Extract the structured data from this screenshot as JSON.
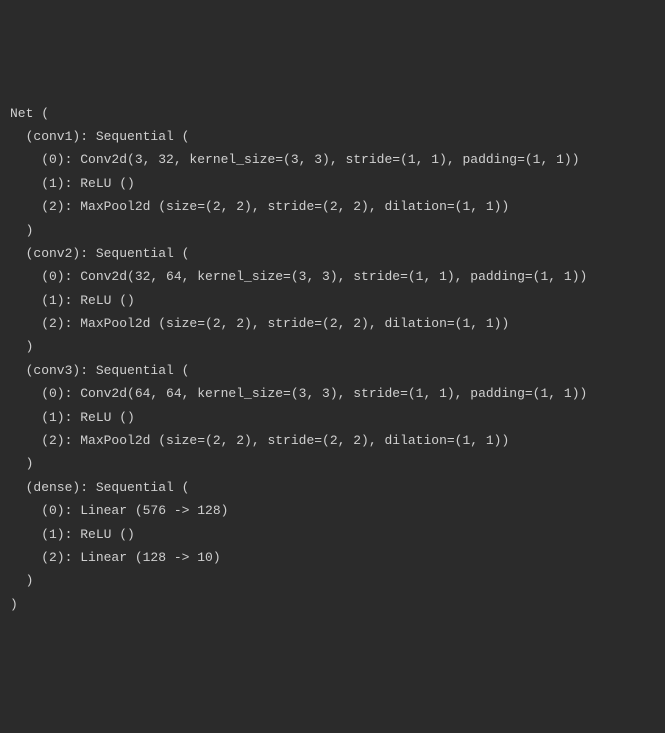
{
  "lines": [
    "Net (",
    "  (conv1): Sequential (",
    "    (0): Conv2d(3, 32, kernel_size=(3, 3), stride=(1, 1), padding=(1, 1))",
    "    (1): ReLU ()",
    "    (2): MaxPool2d (size=(2, 2), stride=(2, 2), dilation=(1, 1))",
    "  )",
    "  (conv2): Sequential (",
    "    (0): Conv2d(32, 64, kernel_size=(3, 3), stride=(1, 1), padding=(1, 1))",
    "    (1): ReLU ()",
    "    (2): MaxPool2d (size=(2, 2), stride=(2, 2), dilation=(1, 1))",
    "  )",
    "  (conv3): Sequential (",
    "    (0): Conv2d(64, 64, kernel_size=(3, 3), stride=(1, 1), padding=(1, 1))",
    "    (1): ReLU ()",
    "    (2): MaxPool2d (size=(2, 2), stride=(2, 2), dilation=(1, 1))",
    "  )",
    "  (dense): Sequential (",
    "    (0): Linear (576 -> 128)",
    "    (1): ReLU ()",
    "    (2): Linear (128 -> 10)",
    "  )",
    ")"
  ]
}
